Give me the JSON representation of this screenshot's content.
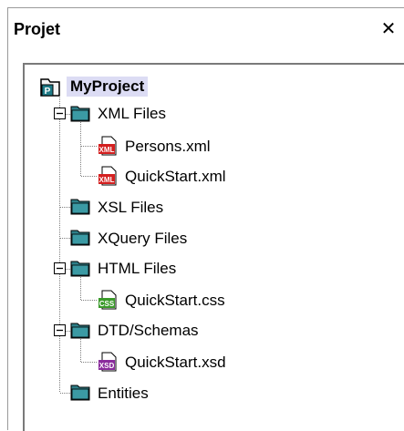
{
  "panel": {
    "title": "Projet",
    "close_glyph": "✕"
  },
  "tree": {
    "root": {
      "label": "MyProject",
      "icon": "project-icon"
    },
    "nodes": [
      {
        "id": "xml-files",
        "label": "XML Files",
        "icon": "folder-icon",
        "expanded": true
      },
      {
        "id": "persons-xml",
        "label": "Persons.xml",
        "icon": "xml-file-icon"
      },
      {
        "id": "quickstart-xml",
        "label": "QuickStart.xml",
        "icon": "xml-file-icon"
      },
      {
        "id": "xsl-files",
        "label": "XSL Files",
        "icon": "folder-icon"
      },
      {
        "id": "xquery-files",
        "label": "XQuery Files",
        "icon": "folder-icon"
      },
      {
        "id": "html-files",
        "label": "HTML Files",
        "icon": "folder-icon",
        "expanded": true
      },
      {
        "id": "quickstart-css",
        "label": "QuickStart.css",
        "icon": "css-file-icon"
      },
      {
        "id": "dtd-schemas",
        "label": "DTD/Schemas",
        "icon": "folder-icon",
        "expanded": true
      },
      {
        "id": "quickstart-xsd",
        "label": "QuickStart.xsd",
        "icon": "xsd-file-icon"
      },
      {
        "id": "entities",
        "label": "Entities",
        "icon": "folder-icon"
      }
    ],
    "badges": {
      "xml": "XML",
      "css": "CSS",
      "xsd": "XSD",
      "project": "P"
    },
    "colors": {
      "folder": "#2e7f88",
      "xml": "#d42020",
      "css": "#3a9a2a",
      "xsd": "#8a2c9c",
      "project": "#1e7a86",
      "selection": "#dcdcf4"
    }
  }
}
